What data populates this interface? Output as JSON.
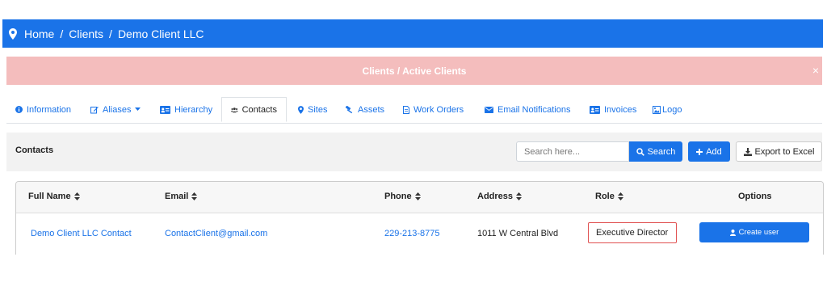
{
  "breadcrumb": {
    "items": [
      "Home",
      "Clients",
      "Demo Client LLC"
    ],
    "separator": "/"
  },
  "alert": {
    "text": "Clients / Active Clients",
    "close": "×"
  },
  "tabs": [
    {
      "label": "Information",
      "icon": "info-icon"
    },
    {
      "label": "Aliases",
      "icon": "edit-icon"
    },
    {
      "label": "Hierarchy",
      "icon": "id-card-icon"
    },
    {
      "label": "Contacts",
      "icon": "users-icon",
      "active": true
    },
    {
      "label": "Sites",
      "icon": "map-pin-icon"
    },
    {
      "label": "Assets",
      "icon": "hammer-icon"
    },
    {
      "label": "Work Orders",
      "icon": "document-icon"
    },
    {
      "label": "Email Notifications",
      "icon": "envelope-icon"
    },
    {
      "label": "Invoices",
      "icon": "id-card-icon"
    },
    {
      "label": "Logo",
      "icon": "image-icon"
    }
  ],
  "panel": {
    "title": "Contacts",
    "search_placeholder": "Search here...",
    "search_label": "Search",
    "add_label": "Add",
    "export_label": "Export to Excel"
  },
  "table": {
    "headers": [
      "Full Name",
      "Email",
      "Phone",
      "Address",
      "Role",
      "Options"
    ],
    "rows": [
      {
        "full_name": "Demo Client LLC Contact",
        "email": "ContactClient@gmail.com",
        "phone": "229-213-8775",
        "address": "1011 W Central Blvd",
        "role": "Executive Director",
        "action": "Create user"
      }
    ]
  },
  "colors": {
    "primary": "#1a73e8",
    "alert_bg": "#f4bdbd",
    "highlight_border": "#e05050"
  }
}
